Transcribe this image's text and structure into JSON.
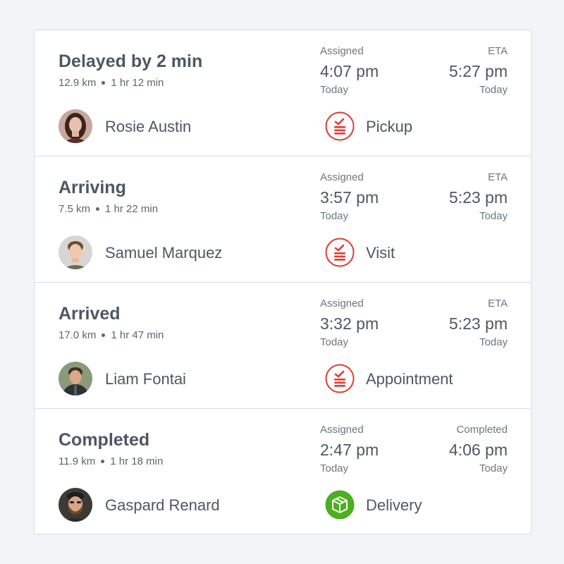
{
  "colors": {
    "background": "#f3f4f7",
    "panel": "#ffffff",
    "border": "#d5dde4",
    "text_primary": "#4c5864",
    "text_secondary": "#6b7782",
    "task_red": "#e03c31",
    "delivery_green": "#4caf1d"
  },
  "orders": [
    {
      "status": "Delayed by 2 min",
      "distance": "12.9 km",
      "duration": "1 hr 12 min",
      "person": "Rosie Austin",
      "avatar": "woman-portrait-avatar",
      "left_label": "Assigned",
      "left_time": "4:07 pm",
      "left_day": "Today",
      "right_label": "ETA",
      "right_time": "5:27 pm",
      "right_day": "Today",
      "task_type": "Pickup",
      "task_icon": "task-checklist-icon"
    },
    {
      "status": "Arriving",
      "distance": "7.5 km",
      "duration": "1 hr 22 min",
      "person": "Samuel Marquez",
      "avatar": "man-portrait-avatar",
      "left_label": "Assigned",
      "left_time": "3:57 pm",
      "left_day": "Today",
      "right_label": "ETA",
      "right_time": "5:23 pm",
      "right_day": "Today",
      "task_type": "Visit",
      "task_icon": "task-checklist-icon"
    },
    {
      "status": "Arrived",
      "distance": "17.0 km",
      "duration": "1 hr 47 min",
      "person": "Liam Fontai",
      "avatar": "man-portrait-avatar",
      "left_label": "Assigned",
      "left_time": "3:32 pm",
      "left_day": "Today",
      "right_label": "ETA",
      "right_time": "5:23 pm",
      "right_day": "Today",
      "task_type": "Appointment",
      "task_icon": "task-checklist-icon"
    },
    {
      "status": "Completed",
      "distance": "11.9 km",
      "duration": "1 hr 18 min",
      "person": "Gaspard Renard",
      "avatar": "bearded-man-portrait-avatar",
      "left_label": "Assigned",
      "left_time": "2:47 pm",
      "left_day": "Today",
      "right_label": "Completed",
      "right_time": "4:06 pm",
      "right_day": "Today",
      "task_type": "Delivery",
      "task_icon": "package-box-icon"
    }
  ]
}
